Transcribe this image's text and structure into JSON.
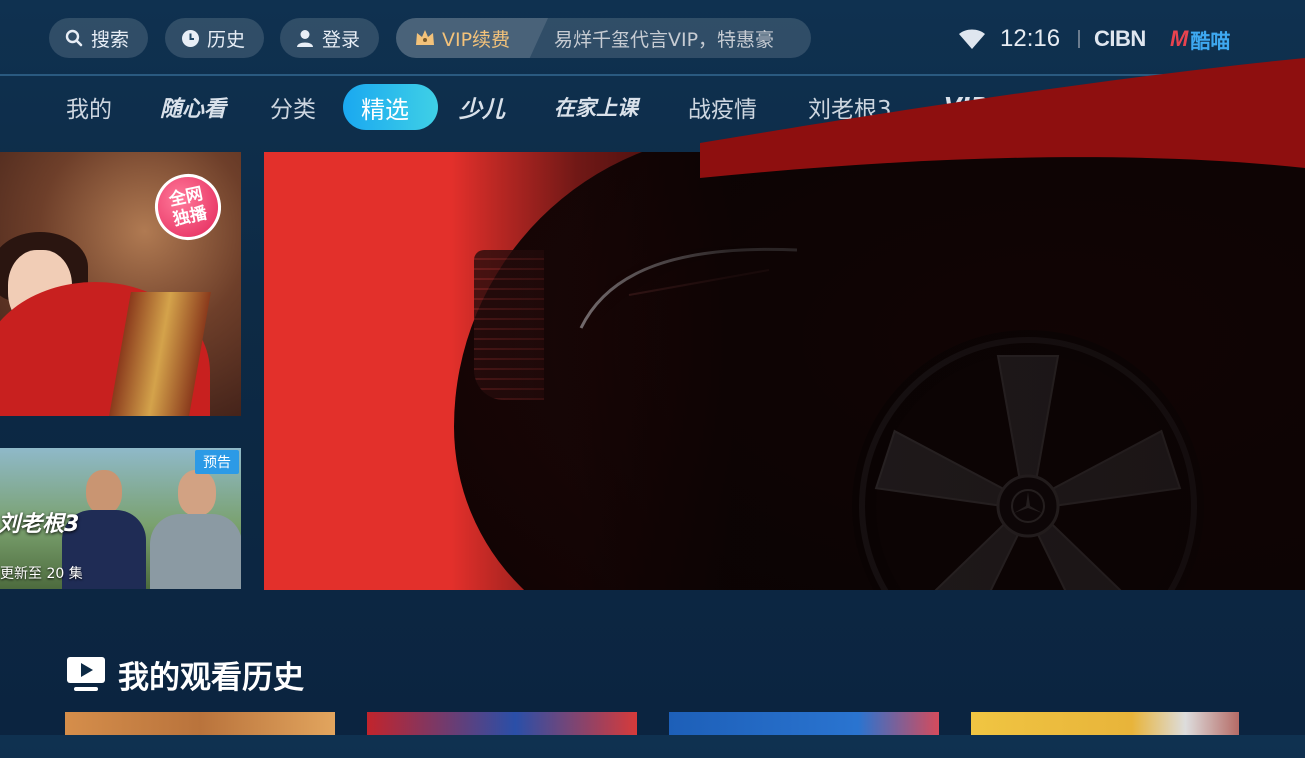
{
  "topbar": {
    "search_label": "搜索",
    "history_label": "历史",
    "login_label": "登录",
    "vip_label": "VIP续费",
    "vip_promo": "易烊千玺代言VIP，特惠豪",
    "time": "12:16",
    "brand_cibn": "CIBN",
    "brand_kumiao": "酷喵",
    "brand_kumiao_m": "M"
  },
  "nav": {
    "tabs": [
      {
        "label": "我的",
        "style": "normal"
      },
      {
        "label": "随心看",
        "style": "italic"
      },
      {
        "label": "分类",
        "style": "normal"
      },
      {
        "label": "精选",
        "style": "active"
      },
      {
        "label": "少儿",
        "style": "italic"
      },
      {
        "label": "在家上课",
        "style": "italic"
      },
      {
        "label": "战疫情",
        "style": "normal"
      },
      {
        "label": "刘老根3",
        "style": "normal"
      },
      {
        "label": "VIP",
        "style": "italic"
      }
    ]
  },
  "posters": {
    "left_top": {
      "badge_line1": "全网",
      "badge_line2": "独播"
    },
    "left_bottom": {
      "tag": "预告",
      "title": "刘老根3",
      "update": "更新至 20 集"
    }
  },
  "history": {
    "title": "我的观看历史"
  },
  "colors": {
    "accent": "#1aa8f0",
    "vip_gold": "#f3c27a",
    "hero_red": "#e3302b",
    "bg": "#0d2a45"
  }
}
